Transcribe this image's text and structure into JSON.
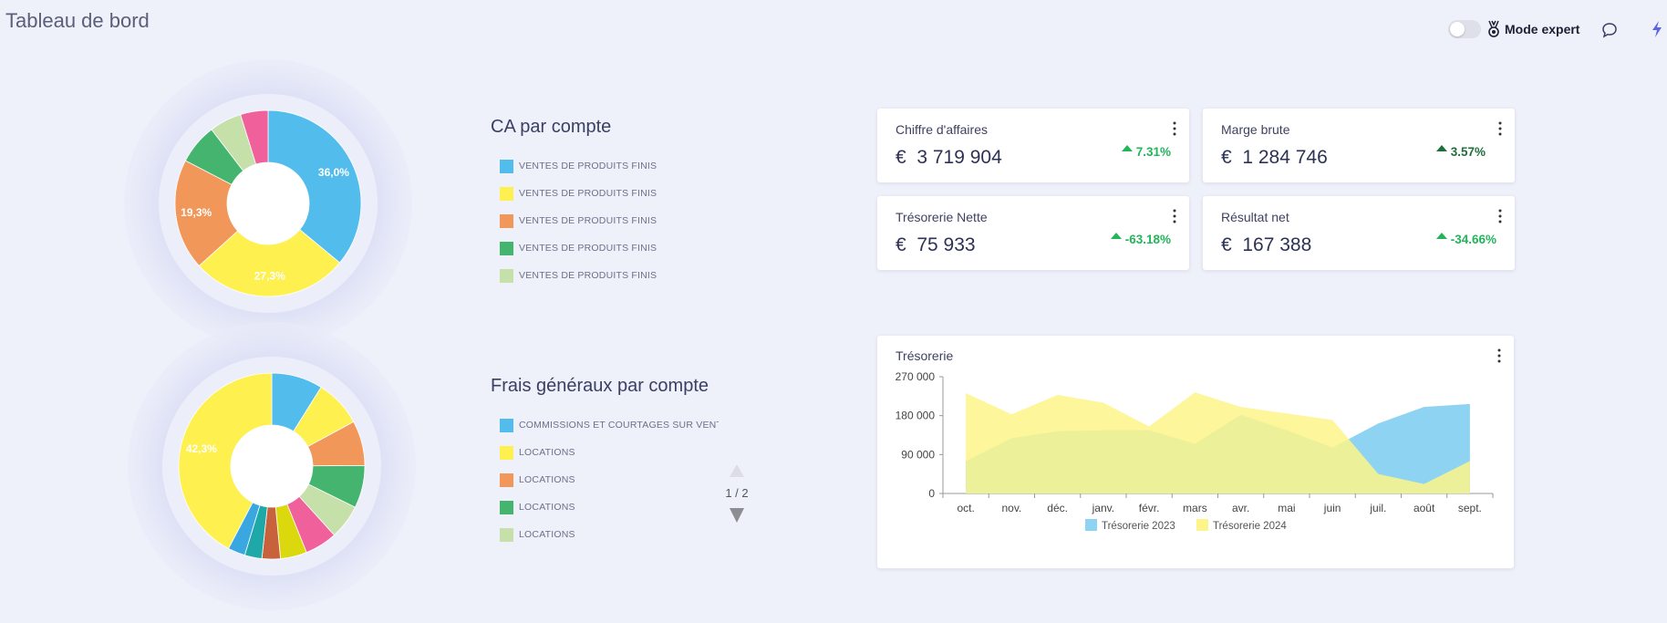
{
  "page": {
    "title": "Tableau de bord"
  },
  "topbar": {
    "mode_label": "Mode expert",
    "toggle_on": false
  },
  "ca_section": {
    "title": "CA par compte",
    "legend": [
      {
        "label": "VENTES DE PRODUITS FINIS",
        "color": "#52bdec"
      },
      {
        "label": "VENTES DE PRODUITS FINIS",
        "color": "#fdf04f"
      },
      {
        "label": "VENTES DE PRODUITS FINIS",
        "color": "#f2975a"
      },
      {
        "label": "VENTES DE PRODUITS FINIS",
        "color": "#44b46e"
      },
      {
        "label": "VENTES DE PRODUITS FINIS",
        "color": "#c5e0a8"
      }
    ],
    "donut": {
      "slices": [
        {
          "value": 36.0,
          "color": "#52bdec",
          "label": "36,0%"
        },
        {
          "value": 27.3,
          "color": "#fdf04f",
          "label": "27,3%"
        },
        {
          "value": 19.3,
          "color": "#f2975a",
          "label": "19,3%"
        },
        {
          "value": 7.0,
          "color": "#44b46e",
          "label": ""
        },
        {
          "value": 5.6,
          "color": "#c5e0a8",
          "label": ""
        },
        {
          "value": 4.8,
          "color": "#f0609b",
          "label": ""
        }
      ]
    }
  },
  "fg_section": {
    "title": "Frais généraux par compte",
    "legend": [
      {
        "label": "COMMISSIONS ET COURTAGES SUR VENTES",
        "color": "#52bdec"
      },
      {
        "label": "LOCATIONS",
        "color": "#fdf04f"
      },
      {
        "label": "LOCATIONS",
        "color": "#f2975a"
      },
      {
        "label": "LOCATIONS",
        "color": "#44b46e"
      },
      {
        "label": "LOCATIONS",
        "color": "#c5e0a8"
      }
    ],
    "pager": "1 / 2",
    "donut": {
      "slices": [
        {
          "value": 8.9,
          "color": "#52bdec",
          "label": ""
        },
        {
          "value": 8.2,
          "color": "#fdf04f",
          "label": ""
        },
        {
          "value": 7.8,
          "color": "#f2975a",
          "label": ""
        },
        {
          "value": 7.4,
          "color": "#44b46e",
          "label": ""
        },
        {
          "value": 6.0,
          "color": "#c5e0a8",
          "label": ""
        },
        {
          "value": 5.6,
          "color": "#f0609b",
          "label": ""
        },
        {
          "value": 4.6,
          "color": "#dcd80e",
          "label": ""
        },
        {
          "value": 3.2,
          "color": "#c8623c",
          "label": ""
        },
        {
          "value": 3.0,
          "color": "#1ea8a8",
          "label": ""
        },
        {
          "value": 3.0,
          "color": "#3aa7e0",
          "label": ""
        },
        {
          "value": 42.3,
          "color": "#fdf04f",
          "label": "42,3%"
        }
      ]
    }
  },
  "kpis": [
    {
      "title": "Chiffre d'affaires",
      "currency": "€",
      "value": "3 719 904",
      "change": "7.31%",
      "change_color": "#22b55a"
    },
    {
      "title": "Marge brute",
      "currency": "€",
      "value": "1 284 746",
      "change": "3.57%",
      "change_color": "#1f6e3a"
    },
    {
      "title": "Trésorerie Nette",
      "currency": "€",
      "value": "75 933",
      "change": "-63.18%",
      "change_color": "#22b55a"
    },
    {
      "title": "Résultat net",
      "currency": "€",
      "value": "167 388",
      "change": "-34.66%",
      "change_color": "#22b55a"
    }
  ],
  "chart_data": {
    "type": "area",
    "title": "Trésorerie",
    "categories": [
      "oct.",
      "nov.",
      "déc.",
      "janv.",
      "févr.",
      "mars",
      "avr.",
      "mai",
      "juin",
      "juil.",
      "août",
      "sept."
    ],
    "ylim": [
      0,
      270000
    ],
    "yticks": [
      0,
      90000,
      180000,
      270000
    ],
    "ytick_labels": [
      "0",
      "90 000",
      "180 000",
      "270 000"
    ],
    "legend_position": "bottom",
    "series": [
      {
        "name": "Trésorerie 2023",
        "color": "#8fd3f2",
        "values": [
          75000,
          128000,
          144000,
          146000,
          146000,
          115000,
          182000,
          146000,
          106000,
          162000,
          200000,
          207000
        ]
      },
      {
        "name": "Trésorerie 2024",
        "color": "#fdf58a",
        "values": [
          232000,
          183000,
          228000,
          210000,
          155000,
          234000,
          200000,
          185000,
          170000,
          45000,
          22000,
          75000
        ]
      }
    ]
  }
}
